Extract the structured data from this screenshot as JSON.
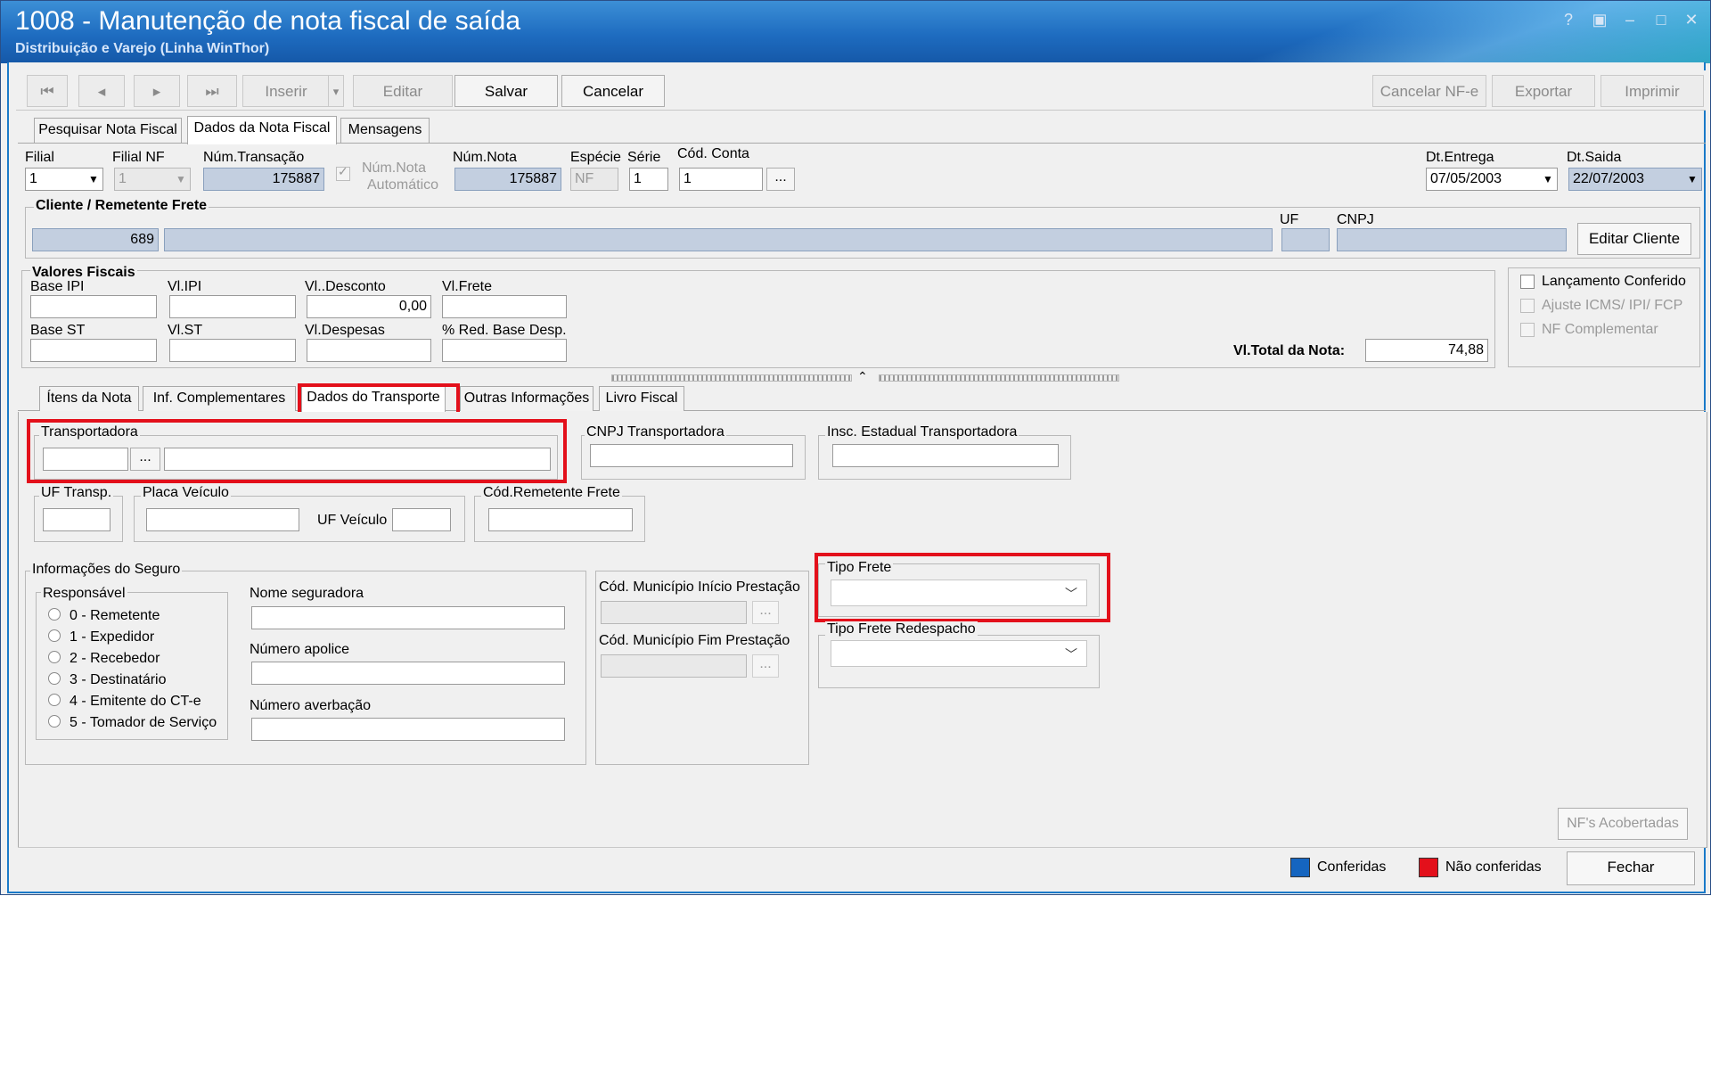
{
  "window": {
    "title": "1008 - Manutenção de nota fiscal de saída",
    "subtitle": "Distribuição e Varejo (Linha WinThor)",
    "controls": [
      "?",
      "▣",
      "–",
      "□",
      "✕"
    ]
  },
  "toolbar": {
    "first": "⏮",
    "prev": "◂",
    "next": "▸",
    "last": "⏭",
    "inserir": "Inserir",
    "inserir_dd": "▾",
    "editar": "Editar",
    "salvar": "Salvar",
    "cancelar": "Cancelar",
    "cancelar_nfe": "Cancelar NF-e",
    "exportar": "Exportar",
    "imprimir": "Imprimir"
  },
  "main_tabs": [
    "Pesquisar Nota Fiscal",
    "Dados da Nota Fiscal",
    "Mensagens"
  ],
  "header": {
    "filial_label": "Filial",
    "filial_value": "1",
    "filial_nf_label": "Filial NF",
    "filial_nf_value": "1",
    "num_transacao_label": "Núm.Transação",
    "num_transacao_value": "175887",
    "num_nota_auto_label": "Núm.Nota\nAutomático",
    "num_nota_auto_line1": "Núm.Nota",
    "num_nota_auto_line2": "Automático",
    "num_nota_label": "Núm.Nota",
    "num_nota_value": "175887",
    "especie_label": "Espécie",
    "especie_value": "NF",
    "serie_label": "Série",
    "serie_value": "1",
    "cod_conta_label": "Cód. Conta",
    "cod_conta_value": "1",
    "ellipsis": "...",
    "dt_entrega_label": "Dt.Entrega",
    "dt_entrega_value": "07/05/2003",
    "dt_saida_label": "Dt.Saida",
    "dt_saida_value": "22/07/2003"
  },
  "cliente": {
    "title": "Cliente / Remetente Frete",
    "code": "689",
    "uf_label": "UF",
    "cnpj_label": "CNPJ",
    "editar_cliente": "Editar Cliente"
  },
  "valores": {
    "title": "Valores Fiscais",
    "base_ipi": "Base IPI",
    "vl_ipi": "Vl.IPI",
    "vl_desconto": "Vl..Desconto",
    "vl_desconto_value": "0,00",
    "vl_frete": "Vl.Frete",
    "base_st": "Base ST",
    "vl_st": "Vl.ST",
    "vl_despesas": "Vl.Despesas",
    "red_base": "% Red. Base Desp.",
    "total_label": "Vl.Total da Nota:",
    "total_value": "74,88"
  },
  "checks": {
    "lancamento": "Lançamento Conferido",
    "ajuste": "Ajuste ICMS/ IPI/ FCP",
    "nf_complementar": "NF Complementar"
  },
  "sub_tabs": [
    "Ítens da Nota",
    "Inf. Complementares",
    "Dados do Transporte",
    "Outras Informações",
    "Livro Fiscal"
  ],
  "transporte": {
    "transportadora": "Transportadora",
    "cnpj_transportadora": "CNPJ Transportadora",
    "insc_estadual": "Insc. Estadual Transportadora",
    "uf_transp": "UF Transp.",
    "placa_veiculo": "Placa Veículo",
    "uf_veiculo": "UF Veículo",
    "cod_remetente": "Cód.Remetente Frete",
    "ellipsis": "..."
  },
  "seguro": {
    "title": "Informações do Seguro",
    "responsavel": "Responsável",
    "options": [
      "0 - Remetente",
      "1 - Expedidor",
      "2 - Recebedor",
      "3 - Destinatário",
      "4 - Emitente do CT-e",
      "5 - Tomador de Serviço"
    ],
    "nome_seguradora": "Nome seguradora",
    "numero_apolice": "Número apolice",
    "numero_averbacao": "Número averbação"
  },
  "municipio": {
    "inicio": "Cód. Município Início Prestação",
    "fim": "Cód. Município Fim Prestação",
    "ellipsis": "..."
  },
  "frete": {
    "tipo_frete": "Tipo Frete",
    "tipo_frete_redespacho": "Tipo Frete Redespacho"
  },
  "bottom": {
    "nfs_acobertadas": "NF's Acobertadas",
    "conferidas": "Conferidas",
    "nao_conferidas": "Não conferidas",
    "fechar": "Fechar"
  },
  "colors": {
    "conferidas": "#1565c0",
    "nao_conferidas": "#e3101b",
    "highlight": "#e3101b"
  }
}
